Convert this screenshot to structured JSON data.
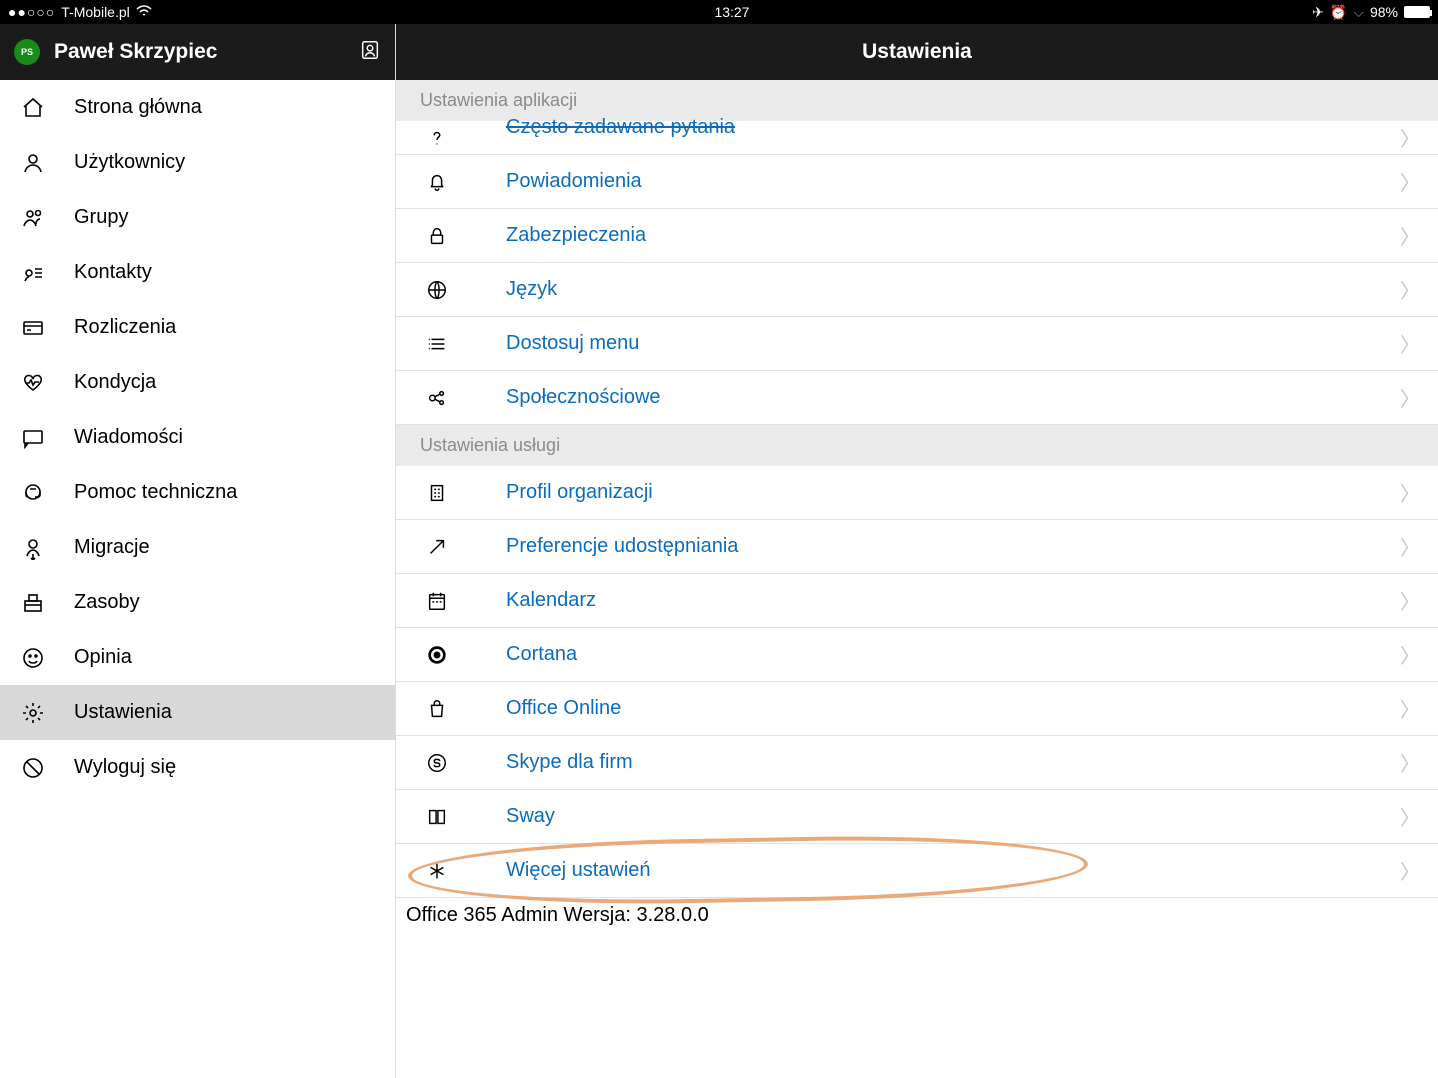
{
  "statusbar": {
    "carrier": "T-Mobile.pl",
    "time": "13:27",
    "battery": "98%"
  },
  "sidebar": {
    "avatar_initials": "PS",
    "username": "Paweł Skrzypiec",
    "items": [
      {
        "label": "Strona główna",
        "icon": "home"
      },
      {
        "label": "Użytkownicy",
        "icon": "user"
      },
      {
        "label": "Grupy",
        "icon": "group"
      },
      {
        "label": "Kontakty",
        "icon": "contacts"
      },
      {
        "label": "Rozliczenia",
        "icon": "billing"
      },
      {
        "label": "Kondycja",
        "icon": "health"
      },
      {
        "label": "Wiadomości",
        "icon": "message"
      },
      {
        "label": "Pomoc techniczna",
        "icon": "support"
      },
      {
        "label": "Migracje",
        "icon": "migrate"
      },
      {
        "label": "Zasoby",
        "icon": "resources"
      },
      {
        "label": "Opinia",
        "icon": "smile"
      },
      {
        "label": "Ustawienia",
        "icon": "gear",
        "selected": true
      },
      {
        "label": "Wyloguj się",
        "icon": "logout"
      }
    ]
  },
  "main": {
    "title": "Ustawienia",
    "section1_title": "Ustawienia aplikacji",
    "section1": [
      {
        "label": "Często zadawane pytania",
        "icon": "question",
        "clipped": true
      },
      {
        "label": "Powiadomienia",
        "icon": "bell"
      },
      {
        "label": "Zabezpieczenia",
        "icon": "lock"
      },
      {
        "label": "Język",
        "icon": "globe"
      },
      {
        "label": "Dostosuj menu",
        "icon": "list"
      },
      {
        "label": "Społecznościowe",
        "icon": "social"
      }
    ],
    "section2_title": "Ustawienia usługi",
    "section2": [
      {
        "label": "Profil organizacji",
        "icon": "building"
      },
      {
        "label": "Preferencje udostępniania",
        "icon": "arrow"
      },
      {
        "label": "Kalendarz",
        "icon": "calendar"
      },
      {
        "label": "Cortana",
        "icon": "cortana"
      },
      {
        "label": "Office Online",
        "icon": "bag"
      },
      {
        "label": "Skype dla firm",
        "icon": "skype"
      },
      {
        "label": "Sway",
        "icon": "sway"
      },
      {
        "label": "Więcej ustawień",
        "icon": "asterisk",
        "highlighted": true
      }
    ],
    "footer": "Office 365 Admin Wersja: 3.28.0.0"
  }
}
